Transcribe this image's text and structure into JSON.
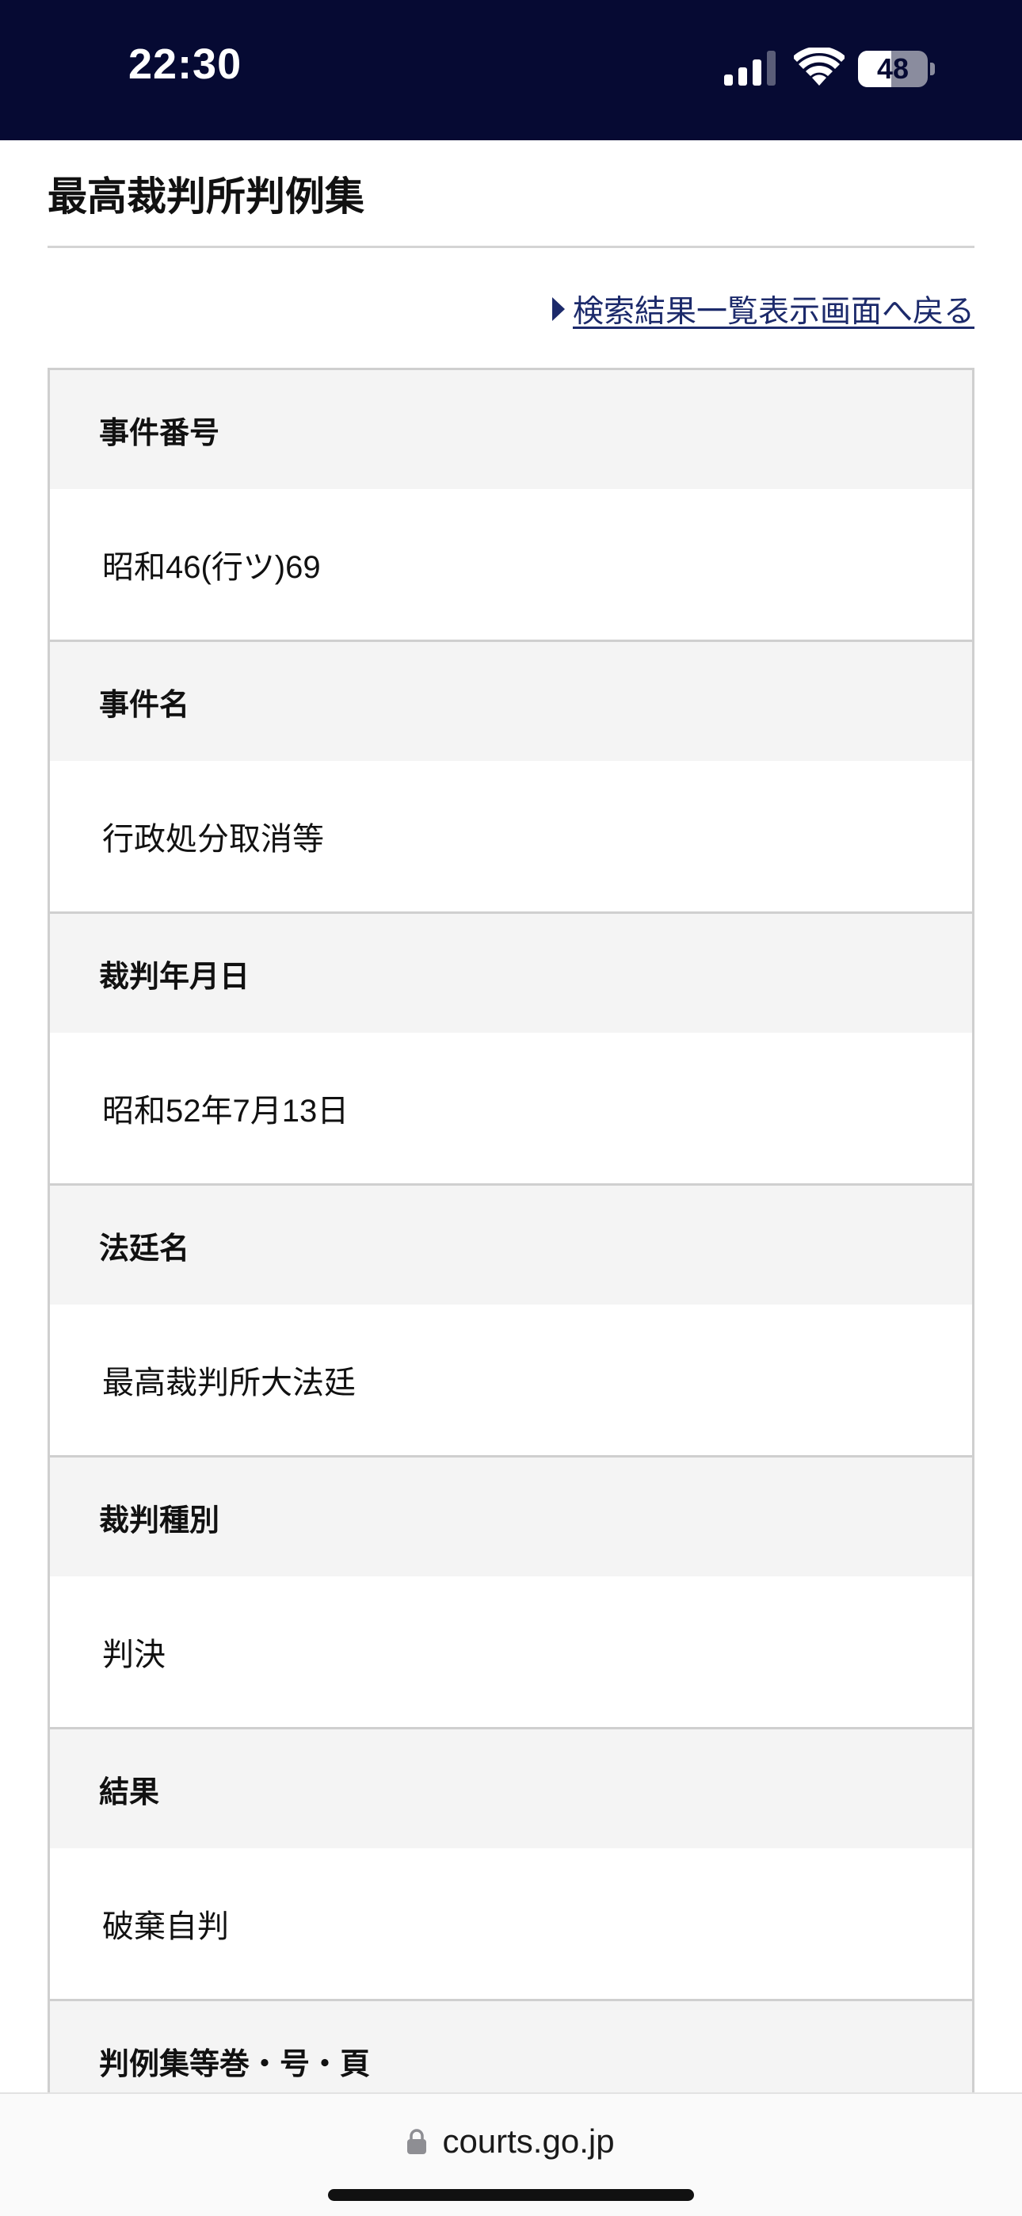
{
  "status_bar": {
    "time": "22:30",
    "battery_level": "48",
    "battery_fraction": 0.48,
    "signal_icon": "cellular-signal-icon",
    "wifi_icon": "wifi-icon",
    "battery_icon": "battery-icon"
  },
  "header": {
    "title": "最高裁判所判例集",
    "back_link_label": "検索結果一覧表示画面へ戻る",
    "back_link_icon": "triangle-right-icon"
  },
  "case_fields": [
    {
      "label": "事件番号",
      "value": "昭和46(行ツ)69"
    },
    {
      "label": "事件名",
      "value": "行政処分取消等"
    },
    {
      "label": "裁判年月日",
      "value": "昭和52年7月13日"
    },
    {
      "label": "法廷名",
      "value": "最高裁判所大法廷"
    },
    {
      "label": "裁判種別",
      "value": "判決"
    },
    {
      "label": "結果",
      "value": "破棄自判"
    },
    {
      "label": "判例集等巻・号・頁",
      "value": ""
    }
  ],
  "browser": {
    "url": "courts.go.jp",
    "lock_icon": "lock-icon"
  },
  "colors": {
    "status_bar_bg": "#060a33",
    "link": "#1c2a6b",
    "header_cell_bg": "#f4f4f4",
    "border": "#cfcfcf"
  }
}
